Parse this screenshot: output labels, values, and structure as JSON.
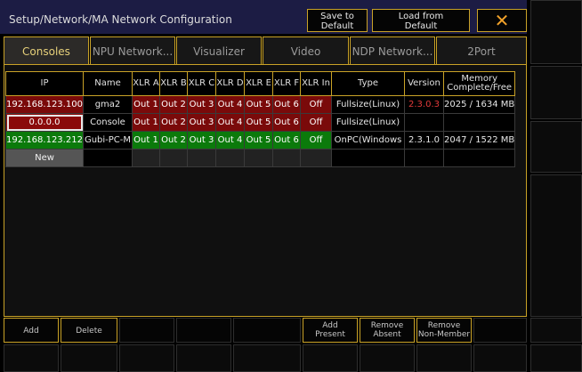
{
  "window": {
    "title": "Setup/Network/MA Network Configuration"
  },
  "toolbar": {
    "save_label_1": "Save to",
    "save_label_2": "Default",
    "load_label_1": "Load from",
    "load_label_2": "Default",
    "close_symbol": "✕"
  },
  "tabs": [
    {
      "label": "Consoles",
      "active": true
    },
    {
      "label": "NPU Network..."
    },
    {
      "label": "Visualizer"
    },
    {
      "label": "Video"
    },
    {
      "label": "NDP Network..."
    },
    {
      "label": "2Port"
    }
  ],
  "table": {
    "headers": [
      "IP",
      "Name",
      "XLR A",
      "XLR B",
      "XLR C",
      "XLR D",
      "XLR E",
      "XLR F",
      "XLR In",
      "Type",
      "Version",
      "Memory",
      "Complete/Free"
    ],
    "rows": [
      {
        "ip": "192.168.123.100",
        "name": "gma2",
        "xlr": [
          "Out 1",
          "Out 2",
          "Out 3",
          "Out 4",
          "Out 5",
          "Out 6"
        ],
        "xlr_in": "Off",
        "type": "Fullsize(Linux)",
        "version": "2.3.0.3",
        "memory": "2025 / 1634 MB",
        "status": "red"
      },
      {
        "ip": "0.0.0.0",
        "name": "Console",
        "xlr": [
          "Out 1",
          "Out 2",
          "Out 3",
          "Out 4",
          "Out 5",
          "Out 6"
        ],
        "xlr_in": "Off",
        "type": "Fullsize(Linux)",
        "version": "",
        "memory": "",
        "status": "red"
      },
      {
        "ip": "192.168.123.212",
        "name": "Gubi-PC-M",
        "xlr": [
          "Out 1",
          "Out 2",
          "Out 3",
          "Out 4",
          "Out 5",
          "Out 6"
        ],
        "xlr_in": "Off",
        "type": "OnPC(Windows",
        "version": "2.3.1.0",
        "memory": "2047 / 1522 MB",
        "status": "green"
      }
    ],
    "new_label": "New"
  },
  "bottom": {
    "add": "Add",
    "delete": "Delete",
    "add_present_1": "Add",
    "add_present_2": "Present",
    "remove_absent_1": "Remove",
    "remove_absent_2": "Absent",
    "remove_nonmember_1": "Remove",
    "remove_nonmember_2": "Non-Member"
  },
  "colors": {
    "accent": "#c9a227",
    "title_bg": "#1c1c44",
    "status_red": "#7a0a0a",
    "status_green": "#0b7a0b",
    "close_x": "#f2a22a"
  }
}
